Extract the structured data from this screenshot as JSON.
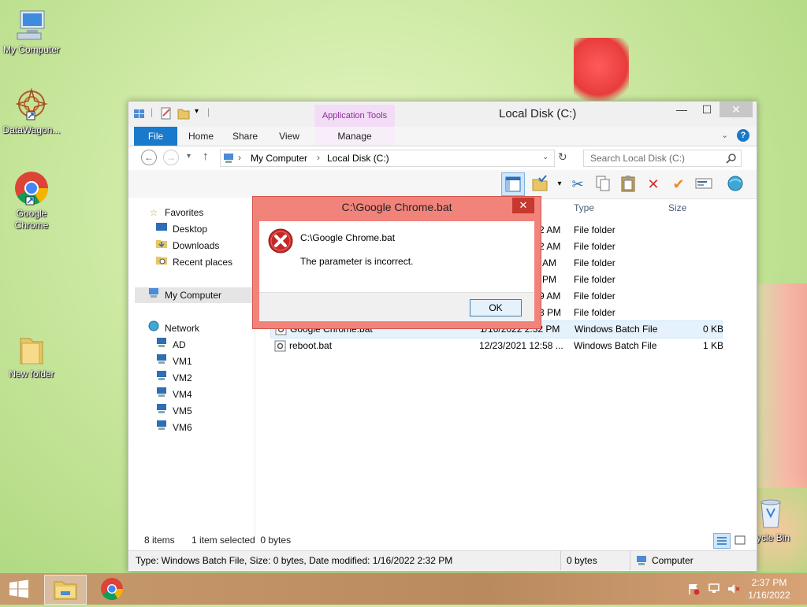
{
  "desktop": {
    "icons": [
      {
        "label": "My Computer",
        "icon": "computer-icon"
      },
      {
        "label": "DataWagon...",
        "icon": "datawagon-icon"
      },
      {
        "label": "Google Chrome",
        "icon": "chrome-icon"
      },
      {
        "label": "New folder",
        "icon": "folder-icon"
      },
      {
        "label": "ycle Bin",
        "icon": "recycle-bin-icon"
      }
    ]
  },
  "explorer": {
    "title": "Local Disk (C:)",
    "contextual_group": "Application Tools",
    "ribbon_tabs": [
      "File",
      "Home",
      "Share",
      "View",
      "Manage"
    ],
    "address": {
      "root": "My Computer",
      "current": "Local Disk (C:)"
    },
    "search_placeholder": "Search Local Disk (C:)",
    "nav": {
      "favorites_label": "Favorites",
      "favorites": [
        "Desktop",
        "Downloads",
        "Recent places"
      ],
      "computer_label": "My Computer",
      "network_label": "Network",
      "network_items": [
        "AD",
        "VM1",
        "VM2",
        "VM4",
        "VM5",
        "VM6"
      ]
    },
    "columns": {
      "type": "Type",
      "size": "Size"
    },
    "rows": [
      {
        "name": "",
        "date": "2 AM",
        "type": "File folder",
        "size": ""
      },
      {
        "name": "",
        "date": "2 AM",
        "type": "File folder",
        "size": ""
      },
      {
        "name": "",
        "date": "AM",
        "type": "File folder",
        "size": ""
      },
      {
        "name": "",
        "date": "PM",
        "type": "File folder",
        "size": ""
      },
      {
        "name": "",
        "date": "9 AM",
        "type": "File folder",
        "size": ""
      },
      {
        "name": "",
        "date": "3 PM",
        "type": "File folder",
        "size": ""
      },
      {
        "name": "Google Chrome.bat",
        "date": "1/16/2022 2:32 PM",
        "type": "Windows Batch File",
        "size": "0 KB"
      },
      {
        "name": "reboot.bat",
        "date": "12/23/2021 12:58 ...",
        "type": "Windows Batch File",
        "size": "1 KB"
      }
    ],
    "status": {
      "items": "8 items",
      "selected": "1 item selected  0 bytes"
    },
    "info": {
      "details": "Type: Windows Batch File, Size: 0 bytes, Date modified: 1/16/2022 2:32 PM",
      "size": "0 bytes",
      "location": "Computer"
    }
  },
  "dialog": {
    "title": "C:\\Google Chrome.bat",
    "heading": "C:\\Google Chrome.bat",
    "message": "The parameter is incorrect.",
    "ok_label": "OK",
    "close_glyph": "✕"
  },
  "taskbar": {
    "time": "2:37 PM",
    "date": "1/16/2022"
  },
  "colors": {
    "file_tab": "#1979ca",
    "dialog_frame": "#f1837a",
    "error_red": "#d32f2f"
  }
}
